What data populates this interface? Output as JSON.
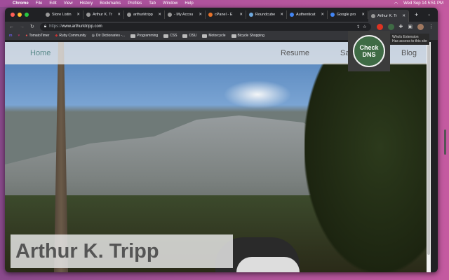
{
  "menubar": {
    "app": "Chrome",
    "items": [
      "File",
      "Edit",
      "View",
      "History",
      "Bookmarks",
      "Profiles",
      "Tab",
      "Window",
      "Help"
    ],
    "datetime": "Wed Sep 14  5:51 PM"
  },
  "tabs": [
    {
      "label": "Store Listin"
    },
    {
      "label": "Arthur K. Tr"
    },
    {
      "label": "arthurktripp"
    },
    {
      "label": "- My Accou"
    },
    {
      "label": "cPanel - E"
    },
    {
      "label": "Roundcube"
    },
    {
      "label": "Authenticat"
    },
    {
      "label": "Google pro"
    },
    {
      "label": "Arthur K. Tr"
    }
  ],
  "address": {
    "scheme": "https://",
    "host": "www.arthurktripp.com"
  },
  "bookmarks": [
    "TomatoTimer",
    "Ruby Community",
    "Dir Dictionaries -...",
    "Programming",
    "CSS",
    "OSU",
    "Motorcycle",
    "Bicycle Shopping"
  ],
  "site": {
    "nav": [
      "Home",
      "Resume",
      "Samples",
      "Blog"
    ],
    "hero_title": "Arthur K. Tripp"
  },
  "extension": {
    "button": "Check DNS",
    "tooltip_title": "WhoIs Extension",
    "tooltip_sub": "Has access to this site"
  }
}
